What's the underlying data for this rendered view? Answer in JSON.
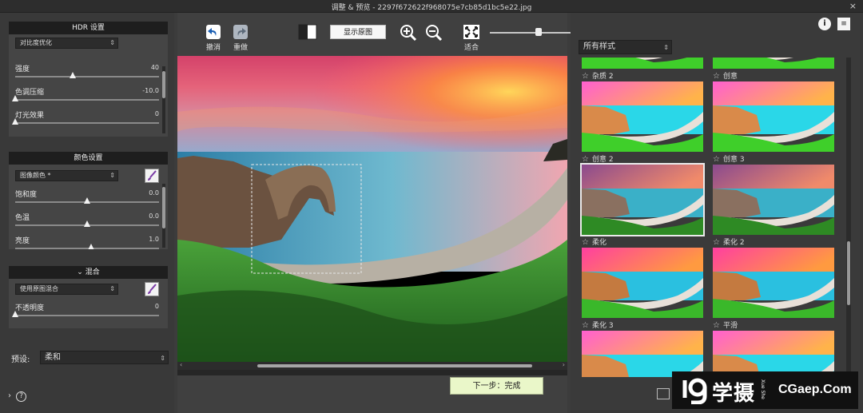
{
  "window": {
    "title": "调整 & 预览 - 2297f672622f968075e7cb85d1bc5e22.jpg",
    "close_glyph": "×"
  },
  "hdr": {
    "header": "HDR 设置",
    "mode": "对比度优化",
    "sliders": [
      {
        "label": "强度",
        "value": "40",
        "pos": 0.4
      },
      {
        "label": "色调压缩",
        "value": "-10.0",
        "pos": 0.0
      },
      {
        "label": "灯光效果",
        "value": "0",
        "pos": 0.0
      }
    ]
  },
  "color": {
    "header": "颜色设置",
    "mode": "图像颜色 *",
    "sliders": [
      {
        "label": "饱和度",
        "value": "0.0",
        "pos": 0.5
      },
      {
        "label": "色温",
        "value": "0.0",
        "pos": 0.5
      },
      {
        "label": "亮度",
        "value": "1.0",
        "pos": 0.53
      }
    ]
  },
  "blend": {
    "header": "混合",
    "collapse_glyph": "⌄",
    "mode": "使用原图混合",
    "sliders": [
      {
        "label": "不透明度",
        "value": "0",
        "pos": 0.0
      }
    ]
  },
  "preset": {
    "label": "预设:",
    "value": "柔和"
  },
  "help": {
    "expand_glyph": "›",
    "help_glyph": "?"
  },
  "toolbar": {
    "undo": "撤消",
    "redo": "重做",
    "show_original": "显示原图",
    "fit": "适合",
    "zoom_level": 0.55
  },
  "canvas": {
    "scroll_left": "‹",
    "scroll_right": "›"
  },
  "next_button": "下一步：完成",
  "styles": {
    "filter": "所有样式",
    "info_glyph": "i",
    "menu_glyph": "≡",
    "star_glyph": "☆",
    "items": [
      {
        "label": "杂质 2",
        "variant": "vivid"
      },
      {
        "label": "创意",
        "variant": "vivid"
      },
      {
        "label": "创意 2",
        "variant": "vivid"
      },
      {
        "label": "创意 3",
        "variant": "vivid"
      },
      {
        "label": "柔化",
        "variant": "soft",
        "selected": true
      },
      {
        "label": "柔化 2",
        "variant": "soft"
      },
      {
        "label": "柔化 3",
        "variant": "warm"
      },
      {
        "label": "平滑",
        "variant": "warm"
      },
      {
        "label": "",
        "variant": "vivid"
      },
      {
        "label": "",
        "variant": "vivid"
      }
    ]
  },
  "watermark": {
    "brand_cn": "学摄",
    "brand_sub": "Xue She",
    "brand_en": "CGaep.Com"
  },
  "colors": {
    "accent_next": "#eaf7c9",
    "panel_header": "#1e1e1e",
    "panel_bg": "#454545"
  }
}
